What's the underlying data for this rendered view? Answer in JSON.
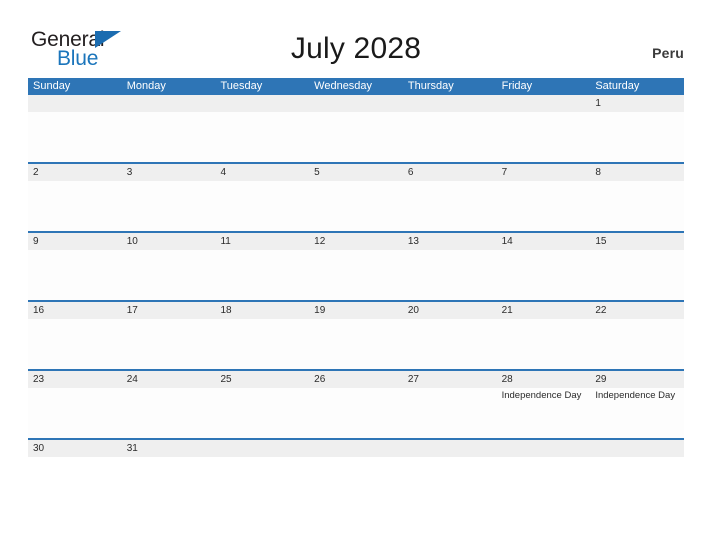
{
  "brand": {
    "name_part1": "General",
    "name_part2": "Blue",
    "flag_icon": "triangle-flag-icon"
  },
  "header": {
    "title": "July 2028",
    "country": "Peru"
  },
  "colors": {
    "header_blue": "#2e75b6",
    "separator_blue": "#2e75b6",
    "daynum_band": "#efefef",
    "logo_blue": "#1b75bb",
    "logo_dark": "#231f20",
    "text": "#2b2b2b"
  },
  "calendar": {
    "day_headers": [
      "Sunday",
      "Monday",
      "Tuesday",
      "Wednesday",
      "Thursday",
      "Friday",
      "Saturday"
    ],
    "weeks": [
      {
        "days": [
          {
            "num": "",
            "events": []
          },
          {
            "num": "",
            "events": []
          },
          {
            "num": "",
            "events": []
          },
          {
            "num": "",
            "events": []
          },
          {
            "num": "",
            "events": []
          },
          {
            "num": "",
            "events": []
          },
          {
            "num": "1",
            "events": []
          }
        ]
      },
      {
        "days": [
          {
            "num": "2",
            "events": []
          },
          {
            "num": "3",
            "events": []
          },
          {
            "num": "4",
            "events": []
          },
          {
            "num": "5",
            "events": []
          },
          {
            "num": "6",
            "events": []
          },
          {
            "num": "7",
            "events": []
          },
          {
            "num": "8",
            "events": []
          }
        ]
      },
      {
        "days": [
          {
            "num": "9",
            "events": []
          },
          {
            "num": "10",
            "events": []
          },
          {
            "num": "11",
            "events": []
          },
          {
            "num": "12",
            "events": []
          },
          {
            "num": "13",
            "events": []
          },
          {
            "num": "14",
            "events": []
          },
          {
            "num": "15",
            "events": []
          }
        ]
      },
      {
        "days": [
          {
            "num": "16",
            "events": []
          },
          {
            "num": "17",
            "events": []
          },
          {
            "num": "18",
            "events": []
          },
          {
            "num": "19",
            "events": []
          },
          {
            "num": "20",
            "events": []
          },
          {
            "num": "21",
            "events": []
          },
          {
            "num": "22",
            "events": []
          }
        ]
      },
      {
        "days": [
          {
            "num": "23",
            "events": []
          },
          {
            "num": "24",
            "events": []
          },
          {
            "num": "25",
            "events": []
          },
          {
            "num": "26",
            "events": []
          },
          {
            "num": "27",
            "events": []
          },
          {
            "num": "28",
            "events": [
              "Independence Day"
            ]
          },
          {
            "num": "29",
            "events": [
              "Independence Day"
            ]
          }
        ]
      },
      {
        "days": [
          {
            "num": "30",
            "events": []
          },
          {
            "num": "31",
            "events": []
          },
          {
            "num": "",
            "events": []
          },
          {
            "num": "",
            "events": []
          },
          {
            "num": "",
            "events": []
          },
          {
            "num": "",
            "events": []
          },
          {
            "num": "",
            "events": []
          }
        ]
      }
    ]
  }
}
